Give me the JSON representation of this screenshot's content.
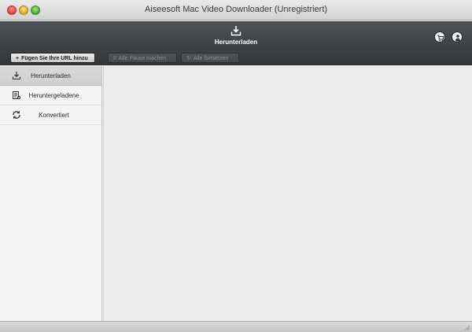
{
  "window": {
    "title": "Aiseesoft Mac Video Downloader (Unregistriert)"
  },
  "toolbar": {
    "download_label": "Herunterladen",
    "download_icon": "download-tray-icon",
    "cart_icon": "cart-icon",
    "user_icon": "user-icon"
  },
  "actions": {
    "add_url": "Fügen Sie Ihre URL hinzu",
    "pause_all": "Alle Pause machen",
    "resume_all": "Alle fortsetzen"
  },
  "sidebar": {
    "items": [
      {
        "label": "Herunterladen",
        "icon": "download-icon",
        "selected": true
      },
      {
        "label": "Heruntergeladene",
        "icon": "downloaded-list-icon",
        "selected": false
      },
      {
        "label": "Konvertiert",
        "icon": "convert-icon",
        "selected": false
      }
    ]
  },
  "colors": {
    "toolbar_bg": "#45494c",
    "sidebar_bg": "#f4f4f4",
    "content_bg": "#ececec",
    "selected_item_bg": "#d4d4d4"
  }
}
